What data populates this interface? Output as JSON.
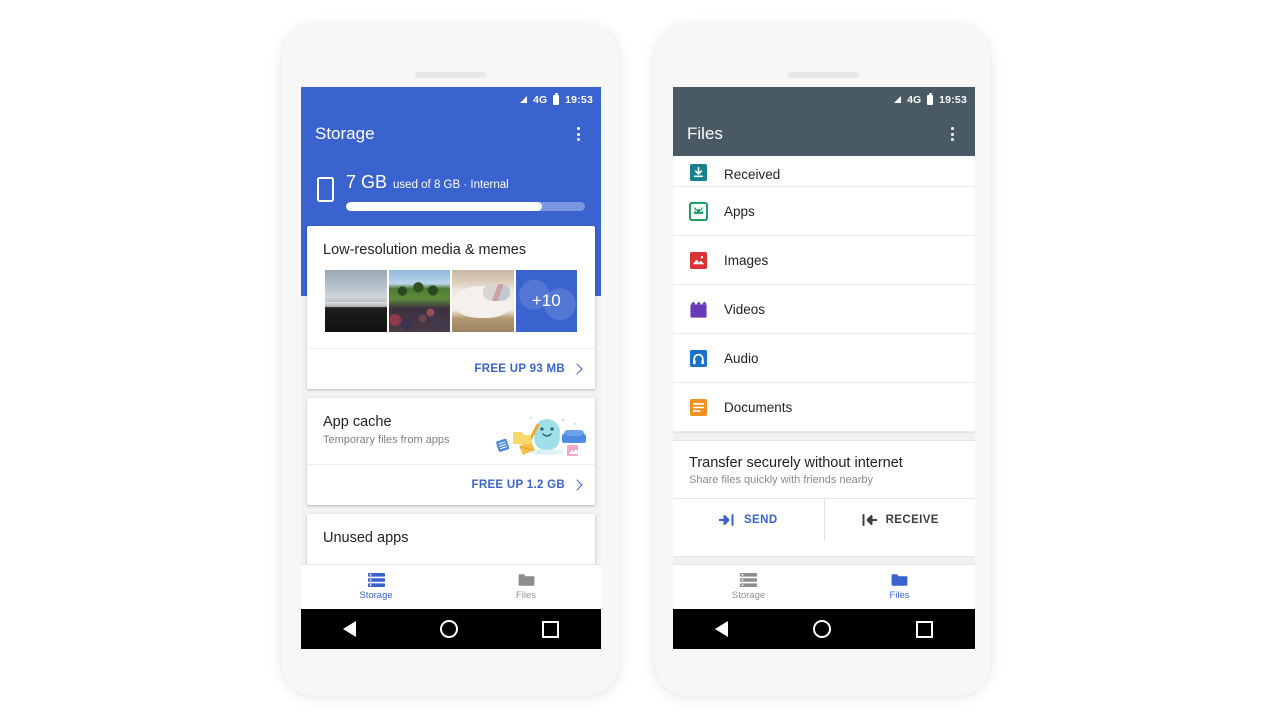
{
  "status_bar": {
    "network": "4G",
    "time": "19:53",
    "signal_icon": "signal-triangle-icon",
    "battery_icon": "battery-icon"
  },
  "colors": {
    "storage_accent": "#3b63cf",
    "files_appbar": "#4a5a64",
    "link_blue": "#3b63cf",
    "page_bg": "#ffffff"
  },
  "storage_phone": {
    "appbar": {
      "title": "Storage",
      "overflow_icon": "kebab-menu-icon"
    },
    "summary": {
      "device_icon": "phone-icon",
      "amount": "7 GB",
      "detail": "used of 8 GB · Internal",
      "used_percent": 82
    },
    "cards": [
      {
        "title": "Low-resolution media & memes",
        "thumbnails": [
          {
            "name": "thumb-beach"
          },
          {
            "name": "thumb-crowd"
          },
          {
            "name": "thumb-cat"
          },
          {
            "name": "thumb-more",
            "overlay": "+10"
          }
        ],
        "action_label": "FREE UP 93 MB",
        "action_icon": "chevron-right-icon"
      },
      {
        "title": "App cache",
        "subtitle": "Temporary files from apps",
        "illustration": "cleaning-blob-illustration",
        "action_label": "FREE UP 1.2 GB",
        "action_icon": "chevron-right-icon"
      },
      {
        "title": "Unused apps"
      }
    ],
    "bottom_nav": [
      {
        "label": "Storage",
        "icon": "storage-list-icon",
        "active": true
      },
      {
        "label": "Files",
        "icon": "folder-icon",
        "active": false
      }
    ]
  },
  "files_phone": {
    "appbar": {
      "title": "Files",
      "overflow_icon": "kebab-menu-icon"
    },
    "list": [
      {
        "label": "Received",
        "icon": "download-box-icon",
        "color": "#18808f",
        "clipped": true
      },
      {
        "label": "Apps",
        "icon": "android-apps-icon",
        "color": "#0f9d58"
      },
      {
        "label": "Images",
        "icon": "image-icon",
        "color": "#db3236"
      },
      {
        "label": "Videos",
        "icon": "video-clapper-icon",
        "color": "#673ab7"
      },
      {
        "label": "Audio",
        "icon": "headphones-icon",
        "color": "#1a73c8"
      },
      {
        "label": "Documents",
        "icon": "document-lines-icon",
        "color": "#f09221"
      }
    ],
    "transfer": {
      "title": "Transfer securely without internet",
      "subtitle": "Share files quickly with friends nearby",
      "send_label": "SEND",
      "send_icon": "arrow-right-to-bar-icon",
      "receive_label": "RECEIVE",
      "receive_icon": "arrow-left-from-bar-icon"
    },
    "bottom_nav": [
      {
        "label": "Storage",
        "icon": "storage-list-icon",
        "active": false
      },
      {
        "label": "Files",
        "icon": "folder-icon",
        "active": true
      }
    ]
  },
  "system_nav": {
    "back_icon": "triangle-back-icon",
    "home_icon": "circle-home-icon",
    "recents_icon": "square-recents-icon"
  }
}
